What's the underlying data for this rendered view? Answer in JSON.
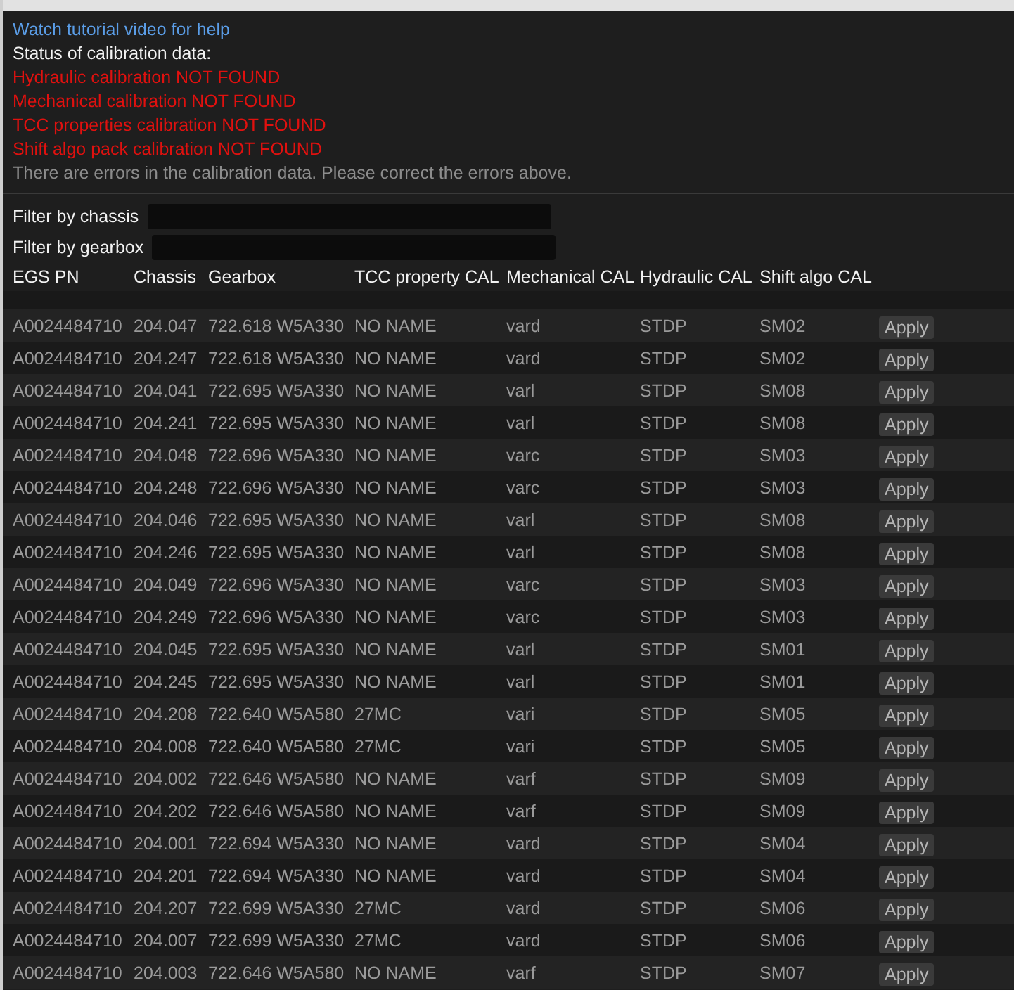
{
  "help_link": "Watch tutorial video for help",
  "status": [
    {
      "kind": "heading",
      "text": "Status of calibration data:"
    },
    {
      "kind": "error",
      "text": "Hydraulic calibration NOT FOUND"
    },
    {
      "kind": "error",
      "text": "Mechanical calibration NOT FOUND"
    },
    {
      "kind": "error",
      "text": "TCC properties calibration NOT FOUND"
    },
    {
      "kind": "error",
      "text": "Shift algo pack calibration NOT FOUND"
    },
    {
      "kind": "note",
      "text": "There are errors in the calibration data. Please correct the errors above."
    }
  ],
  "filters": [
    {
      "label": "Filter by chassis"
    },
    {
      "label": "Filter by gearbox"
    }
  ],
  "table": {
    "columns": [
      "EGS PN",
      "Chassis",
      "Gearbox",
      "TCC property CAL",
      "Mechanical CAL",
      "Hydraulic CAL",
      "Shift algo CAL"
    ],
    "rows": [
      {
        "cells": [
          "A0024484710",
          "204.047",
          "722.618 W5A330",
          "NO NAME",
          "vard",
          "STDP",
          "SM02"
        ],
        "button": "Apply"
      },
      {
        "cells": [
          "A0024484710",
          "204.247",
          "722.618 W5A330",
          "NO NAME",
          "vard",
          "STDP",
          "SM02"
        ],
        "button": "Apply"
      },
      {
        "cells": [
          "A0024484710",
          "204.041",
          "722.695 W5A330",
          "NO NAME",
          "varl",
          "STDP",
          "SM08"
        ],
        "button": "Apply"
      },
      {
        "cells": [
          "A0024484710",
          "204.241",
          "722.695 W5A330",
          "NO NAME",
          "varl",
          "STDP",
          "SM08"
        ],
        "button": "Apply"
      },
      {
        "cells": [
          "A0024484710",
          "204.048",
          "722.696 W5A330",
          "NO NAME",
          "varc",
          "STDP",
          "SM03"
        ],
        "button": "Apply"
      },
      {
        "cells": [
          "A0024484710",
          "204.248",
          "722.696 W5A330",
          "NO NAME",
          "varc",
          "STDP",
          "SM03"
        ],
        "button": "Apply"
      },
      {
        "cells": [
          "A0024484710",
          "204.046",
          "722.695 W5A330",
          "NO NAME",
          "varl",
          "STDP",
          "SM08"
        ],
        "button": "Apply"
      },
      {
        "cells": [
          "A0024484710",
          "204.246",
          "722.695 W5A330",
          "NO NAME",
          "varl",
          "STDP",
          "SM08"
        ],
        "button": "Apply"
      },
      {
        "cells": [
          "A0024484710",
          "204.049",
          "722.696 W5A330",
          "NO NAME",
          "varc",
          "STDP",
          "SM03"
        ],
        "button": "Apply"
      },
      {
        "cells": [
          "A0024484710",
          "204.249",
          "722.696 W5A330",
          "NO NAME",
          "varc",
          "STDP",
          "SM03"
        ],
        "button": "Apply"
      },
      {
        "cells": [
          "A0024484710",
          "204.045",
          "722.695 W5A330",
          "NO NAME",
          "varl",
          "STDP",
          "SM01"
        ],
        "button": "Apply"
      },
      {
        "cells": [
          "A0024484710",
          "204.245",
          "722.695 W5A330",
          "NO NAME",
          "varl",
          "STDP",
          "SM01"
        ],
        "button": "Apply"
      },
      {
        "cells": [
          "A0024484710",
          "204.208",
          "722.640 W5A580",
          "27MC",
          "vari",
          "STDP",
          "SM05"
        ],
        "button": "Apply"
      },
      {
        "cells": [
          "A0024484710",
          "204.008",
          "722.640 W5A580",
          "27MC",
          "vari",
          "STDP",
          "SM05"
        ],
        "button": "Apply"
      },
      {
        "cells": [
          "A0024484710",
          "204.002",
          "722.646 W5A580",
          "NO NAME",
          "varf",
          "STDP",
          "SM09"
        ],
        "button": "Apply"
      },
      {
        "cells": [
          "A0024484710",
          "204.202",
          "722.646 W5A580",
          "NO NAME",
          "varf",
          "STDP",
          "SM09"
        ],
        "button": "Apply"
      },
      {
        "cells": [
          "A0024484710",
          "204.001",
          "722.694 W5A330",
          "NO NAME",
          "vard",
          "STDP",
          "SM04"
        ],
        "button": "Apply"
      },
      {
        "cells": [
          "A0024484710",
          "204.201",
          "722.694 W5A330",
          "NO NAME",
          "vard",
          "STDP",
          "SM04"
        ],
        "button": "Apply"
      },
      {
        "cells": [
          "A0024484710",
          "204.207",
          "722.699 W5A330",
          "27MC",
          "vard",
          "STDP",
          "SM06"
        ],
        "button": "Apply"
      },
      {
        "cells": [
          "A0024484710",
          "204.007",
          "722.699 W5A330",
          "27MC",
          "vard",
          "STDP",
          "SM06"
        ],
        "button": "Apply"
      },
      {
        "cells": [
          "A0024484710",
          "204.003",
          "722.646 W5A580",
          "NO NAME",
          "varf",
          "STDP",
          "SM07"
        ],
        "button": "Apply"
      }
    ]
  }
}
